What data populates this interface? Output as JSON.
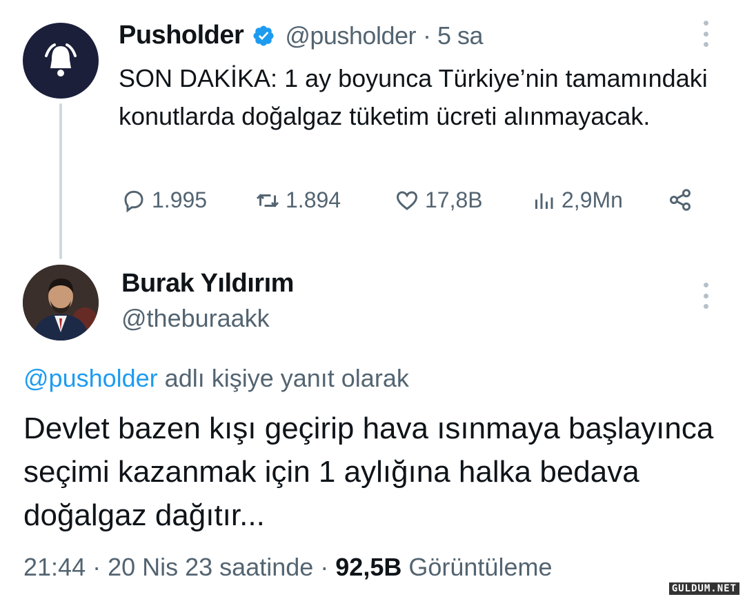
{
  "tweet1": {
    "name": "Pusholder",
    "handle": "@pusholder",
    "time": "· 5 sa",
    "text": "SON DAKİKA: 1 ay boyunca Türkiye’nin tamamındaki konutlarda doğalgaz tüketim ücreti alınmayacak.",
    "actions": {
      "replies": "1.995",
      "retweets": "1.894",
      "likes": "17,8B",
      "views": "2,9Mn"
    }
  },
  "tweet2": {
    "name": "Burak Yıldırım",
    "handle": "@theburaakk",
    "reply_to_handle": "@pusholder",
    "reply_to_suffix": " adlı kişiye yanıt olarak",
    "text": "Devlet bazen kışı geçirip hava ısınmaya başlayınca seçimi kazanmak için 1 aylığına halka bedava doğalgaz dağıtır...",
    "meta_time": "21:44 · 20 Nis 23 saatinde · ",
    "meta_views": "92,5B",
    "meta_views_label": " Görüntüleme"
  },
  "watermark": "GULDUM.NET",
  "colors": {
    "accent": "#1d9bf0",
    "secondary_text": "#536471",
    "primary_text": "#0f1419",
    "avatar_bg": "#1b1f3a"
  }
}
